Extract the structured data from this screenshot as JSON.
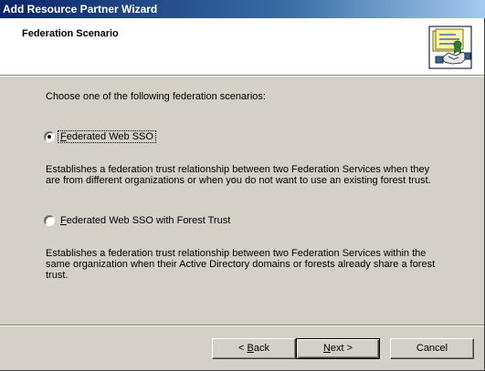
{
  "window": {
    "title": "Add Resource Partner Wizard"
  },
  "header": {
    "title": "Federation Scenario",
    "icon": "partner-certificate-handshake-icon"
  },
  "main": {
    "intro": "Choose one of the following federation scenarios:",
    "options": [
      {
        "label_prefix": "",
        "label_mnemonic": "F",
        "label_rest": "ederated Web SSO",
        "checked": true,
        "description": "Establishes a federation trust relationship between two Federation Services when they are from different organizations or when you do not want to use an existing forest trust."
      },
      {
        "label_prefix": "",
        "label_mnemonic": "F",
        "label_rest": "ederated Web SSO with Forest Trust",
        "checked": false,
        "description": "Establishes a federation trust relationship between two Federation Services within the same organization when their Active Directory domains or forests already share a forest trust."
      }
    ]
  },
  "footer": {
    "back": {
      "prefix": "< ",
      "mnemonic": "B",
      "rest": "ack"
    },
    "next": {
      "prefix": "",
      "mnemonic": "N",
      "rest": "ext >"
    },
    "cancel": "Cancel"
  },
  "colors": {
    "titlebar_start": "#0a246a",
    "titlebar_end": "#a6caf0",
    "face": "#d4d0c8",
    "header_bg": "#ffffff"
  }
}
